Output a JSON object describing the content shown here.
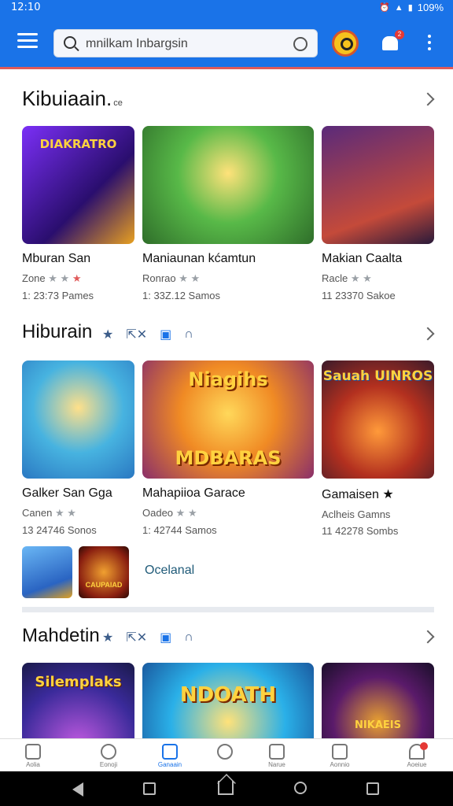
{
  "status_bar": {
    "time": "12:10",
    "battery": "109%"
  },
  "app_bar": {
    "search_text": "mnilkam Inbargsin",
    "notification_count": "2"
  },
  "sections": [
    {
      "title": "Kibuiaain.",
      "subtitle": "ce",
      "cards": [
        {
          "title": "Mburan San",
          "meta": "Zone",
          "stats": "1: 23:73 Pames",
          "art": "DIAKRATRO",
          "bg": "#6a2ccf"
        },
        {
          "title": "Maniaunan kćamtun",
          "meta": "Ronrao",
          "stats": "1: 33Z.12 Samos",
          "art": "",
          "bg": "#4fae3b"
        },
        {
          "title": "Makian Caalta",
          "meta": "Racle",
          "stats": "11 23370 Sakoe",
          "art": "",
          "bg": "#7a3b6f"
        }
      ]
    },
    {
      "title": "Hiburain",
      "cards": [
        {
          "title": "Galker San Gga",
          "meta": "Canen",
          "stats": "13 24746 Sonos",
          "art": "",
          "bg": "#35a9d6"
        },
        {
          "title": "Mahapiioa Garace",
          "meta": "Oadeo",
          "stats": "1: 42744 Samos",
          "art_top": "Niagihs",
          "art_bottom": "MDBARAS",
          "bg": "#d9771c"
        },
        {
          "title": "Gamaisen",
          "meta": "Aclheis Gamns",
          "stats": "11 42278 Sombs",
          "art": "Sauah UINROS",
          "bg": "#c03a2a"
        }
      ],
      "mini_cards": [
        {
          "bg": "#4c8fd9",
          "art": ""
        },
        {
          "bg": "#b3331f",
          "art": "CAUPAIAD"
        }
      ],
      "discover_label": "Ocelanal"
    },
    {
      "title": "Mahdetin",
      "cards": [
        {
          "title": "",
          "meta": "",
          "stats": "",
          "art": "Silemplaks",
          "bg": "#2b3e9a"
        },
        {
          "title": "",
          "meta": "",
          "stats": "",
          "art": "NDOATH",
          "bg": "#1f9ad6"
        },
        {
          "title": "",
          "meta": "",
          "stats": "",
          "art": "NIKAEIS",
          "bg": "#2a1f4a"
        }
      ]
    }
  ],
  "bottom_nav": [
    {
      "label": "Aolia",
      "active": false
    },
    {
      "label": "Eonoji",
      "active": false
    },
    {
      "label": "Ganaain",
      "active": true
    },
    {
      "label": "",
      "active": false
    },
    {
      "label": "Narue",
      "active": false
    },
    {
      "label": "Aonnio",
      "active": false
    },
    {
      "label": "Aoeiue",
      "active": false,
      "badge": true
    }
  ],
  "colors": {
    "primary": "#1a73e8",
    "accent_red": "#e53935"
  }
}
